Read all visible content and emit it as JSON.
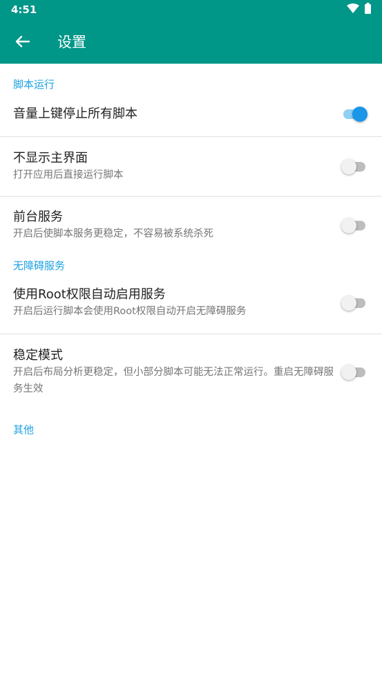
{
  "status": {
    "time": "4:51",
    "wifi_icon": "wifi-icon",
    "battery_icon": "battery-icon"
  },
  "appbar": {
    "title": "设置",
    "back_icon": "arrow-left-icon",
    "color": "#009688"
  },
  "accent": "#1ba1e2",
  "sections": {
    "script_run": {
      "header": "脚本运行",
      "volume_up_stop": {
        "title": "音量上键停止所有脚本",
        "checked": true
      },
      "hide_main": {
        "title": "不显示主界面",
        "summary": "打开应用后直接运行脚本",
        "checked": false
      },
      "foreground": {
        "title": "前台服务",
        "summary": "开启后使脚本服务更稳定，不容易被系统杀死",
        "checked": false
      }
    },
    "accessibility": {
      "header": "无障碍服务",
      "root_enable": {
        "title": "使用Root权限自动启用服务",
        "summary": "开启后运行脚本会使用Root权限自动开启无障碍服务",
        "checked": false
      },
      "stable_mode": {
        "title": "稳定模式",
        "summary": "开启后布局分析更稳定，但小部分脚本可能无法正常运行。重启无障碍服务生效",
        "checked": false
      }
    },
    "other": {
      "header": "其他"
    }
  }
}
